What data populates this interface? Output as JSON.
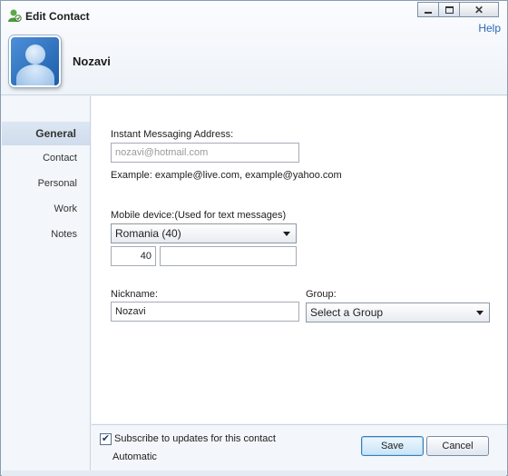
{
  "window": {
    "title": "Edit Contact",
    "help_label": "Help",
    "controls": [
      "minimize",
      "maximize",
      "close"
    ]
  },
  "contact": {
    "name": "Nozavi"
  },
  "sidebar": {
    "items": [
      {
        "label": "General",
        "active": true
      },
      {
        "label": "Contact",
        "active": false
      },
      {
        "label": "Personal",
        "active": false
      },
      {
        "label": "Work",
        "active": false
      },
      {
        "label": "Notes",
        "active": false
      }
    ]
  },
  "form": {
    "im_label": "Instant Messaging Address:",
    "im_value": "nozavi@hotmail.com",
    "im_example": "Example: example@live.com, example@yahoo.com",
    "mobile_label": "Mobile device:(Used for text messages)",
    "country_selected": "Romania (40)",
    "country_code": "40",
    "mobile_number": "",
    "nickname_label": "Nickname:",
    "nickname_value": "Nozavi",
    "group_label": "Group:",
    "group_selected": "Select a Group"
  },
  "footer": {
    "subscribe_label": "Subscribe to updates for this contact",
    "subscribe_checked": true,
    "automatic_label": "Automatic",
    "save_label": "Save",
    "cancel_label": "Cancel"
  },
  "colors": {
    "accent": "#2a69b8",
    "sidebar_active": "#d6e2f0"
  }
}
